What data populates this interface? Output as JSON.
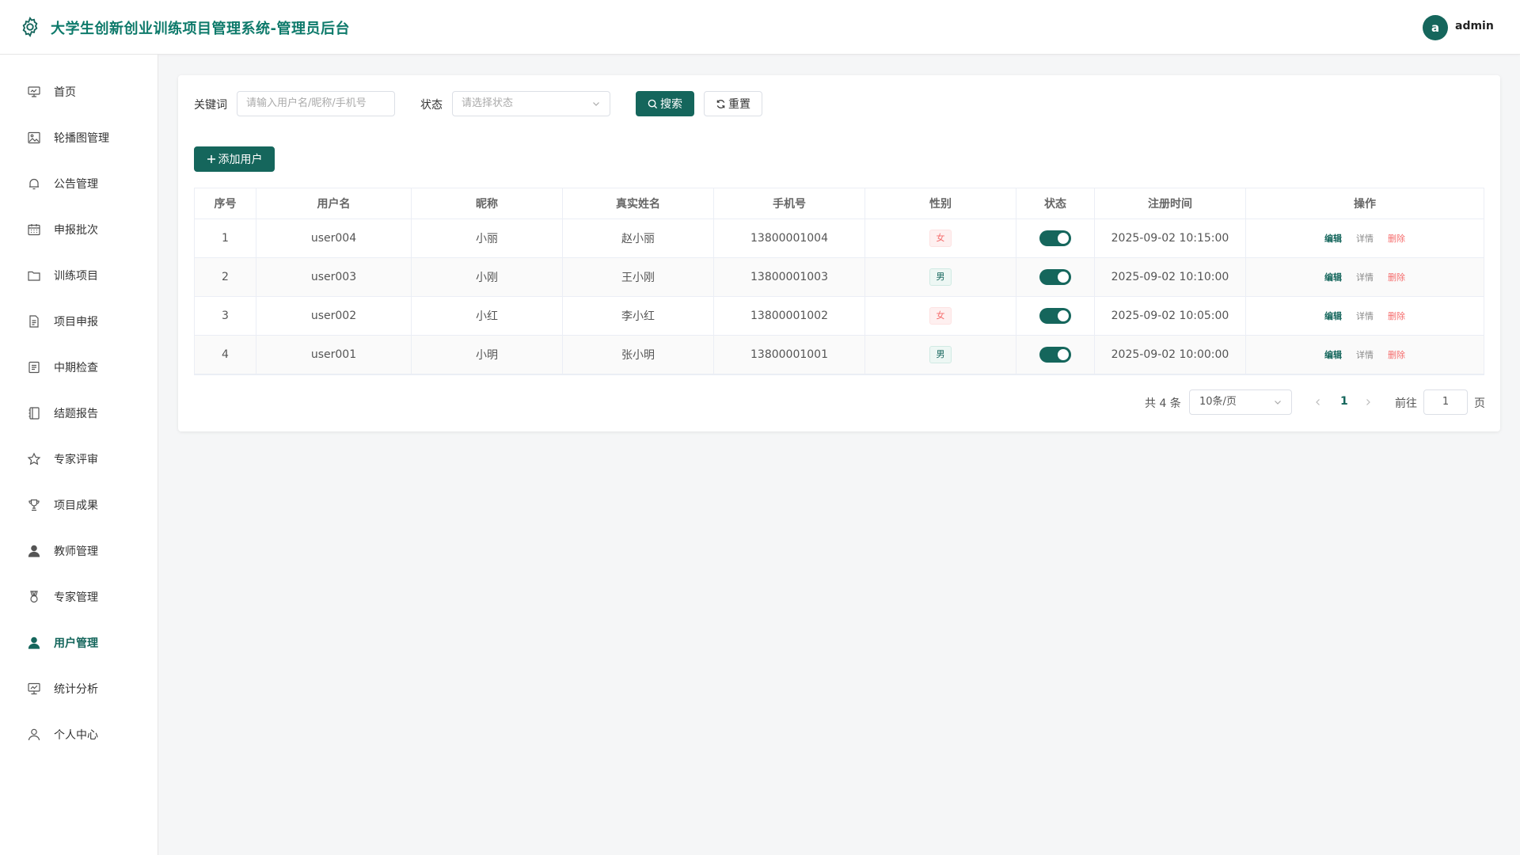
{
  "header": {
    "title": "大学生创新创业训练项目管理系统-管理员后台",
    "avatar_letter": "a",
    "username": "admin"
  },
  "sidebar": {
    "items": [
      {
        "label": "首页",
        "icon": "monitor-icon"
      },
      {
        "label": "轮播图管理",
        "icon": "image-icon"
      },
      {
        "label": "公告管理",
        "icon": "bell-icon"
      },
      {
        "label": "申报批次",
        "icon": "calendar-icon"
      },
      {
        "label": "训练项目",
        "icon": "folder-icon"
      },
      {
        "label": "项目申报",
        "icon": "document-icon"
      },
      {
        "label": "中期检查",
        "icon": "tickets-icon"
      },
      {
        "label": "结题报告",
        "icon": "notebook-icon"
      },
      {
        "label": "专家评审",
        "icon": "star-icon"
      },
      {
        "label": "项目成果",
        "icon": "trophy-icon"
      },
      {
        "label": "教师管理",
        "icon": "user-filled-icon"
      },
      {
        "label": "专家管理",
        "icon": "medal-icon"
      },
      {
        "label": "用户管理",
        "icon": "user-filled-icon"
      },
      {
        "label": "统计分析",
        "icon": "data-board-icon"
      },
      {
        "label": "个人中心",
        "icon": "user-icon"
      }
    ],
    "active_index": 12
  },
  "filter": {
    "keyword_label": "关键词",
    "keyword_placeholder": "请输入用户名/昵称/手机号",
    "status_label": "状态",
    "status_placeholder": "请选择状态",
    "search_label": "搜索",
    "reset_label": "重置"
  },
  "add_button": "添加用户",
  "table": {
    "columns": [
      "序号",
      "用户名",
      "昵称",
      "真实姓名",
      "手机号",
      "性别",
      "状态",
      "注册时间",
      "操作"
    ],
    "rows": [
      {
        "index": "1",
        "username": "user004",
        "nickname": "小丽",
        "realname": "赵小丽",
        "phone": "13800001004",
        "gender": "女",
        "enabled": true,
        "created": "2025-09-02 10:15:00"
      },
      {
        "index": "2",
        "username": "user003",
        "nickname": "小刚",
        "realname": "王小刚",
        "phone": "13800001003",
        "gender": "男",
        "enabled": true,
        "created": "2025-09-02 10:10:00"
      },
      {
        "index": "3",
        "username": "user002",
        "nickname": "小红",
        "realname": "李小红",
        "phone": "13800001002",
        "gender": "女",
        "enabled": true,
        "created": "2025-09-02 10:05:00"
      },
      {
        "index": "4",
        "username": "user001",
        "nickname": "小明",
        "realname": "张小明",
        "phone": "13800001001",
        "gender": "男",
        "enabled": true,
        "created": "2025-09-02 10:00:00"
      }
    ],
    "actions": {
      "edit": "编辑",
      "detail": "详情",
      "delete": "删除"
    }
  },
  "pagination": {
    "total_text": "共 4 条",
    "page_size": "10条/页",
    "current_page": "1",
    "goto_label": "前往",
    "goto_value": "1",
    "page_suffix": "页"
  },
  "colors": {
    "primary": "#15665c",
    "title": "#0e7a6b",
    "danger": "#f56c6c"
  }
}
